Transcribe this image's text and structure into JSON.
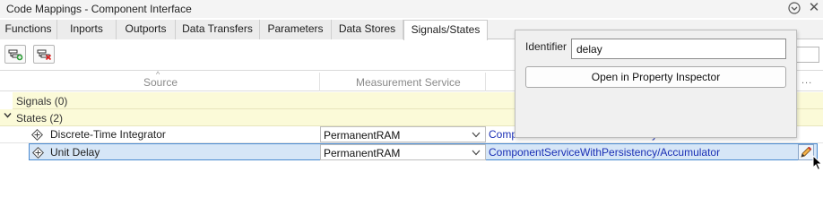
{
  "window": {
    "title": "Code Mappings - Component Interface"
  },
  "tabs": [
    {
      "label": "Functions"
    },
    {
      "label": "Inports"
    },
    {
      "label": "Outports"
    },
    {
      "label": "Data Transfers"
    },
    {
      "label": "Parameters"
    },
    {
      "label": "Data Stores"
    },
    {
      "label": "Signals/States",
      "active": true
    }
  ],
  "columns": {
    "source": "Source",
    "measurement": "Measurement Service",
    "more": "..."
  },
  "groups": {
    "signals": "Signals (0)",
    "states": "States (2)"
  },
  "rows": [
    {
      "name": "Discrete-Time Integrator",
      "measurement": "PermanentRAM",
      "link": "ComponentServiceWithPersistency/Accumulator",
      "selected": false
    },
    {
      "name": "Unit Delay",
      "measurement": "PermanentRAM",
      "link": "ComponentServiceWithPersistency/Accumulator",
      "selected": true
    }
  ],
  "popup": {
    "identifier_label": "Identifier",
    "identifier_value": "delay",
    "open_button": "Open in Property Inspector"
  },
  "icons": {
    "add": "add-mapping-icon",
    "remove": "remove-mapping-icon",
    "state": "state-diamond-icon",
    "edit": "edit-pencil-icon"
  },
  "colors": {
    "group_row": "#fbfad8",
    "selection": "#d6e6f7",
    "link": "#1a2fb5"
  }
}
